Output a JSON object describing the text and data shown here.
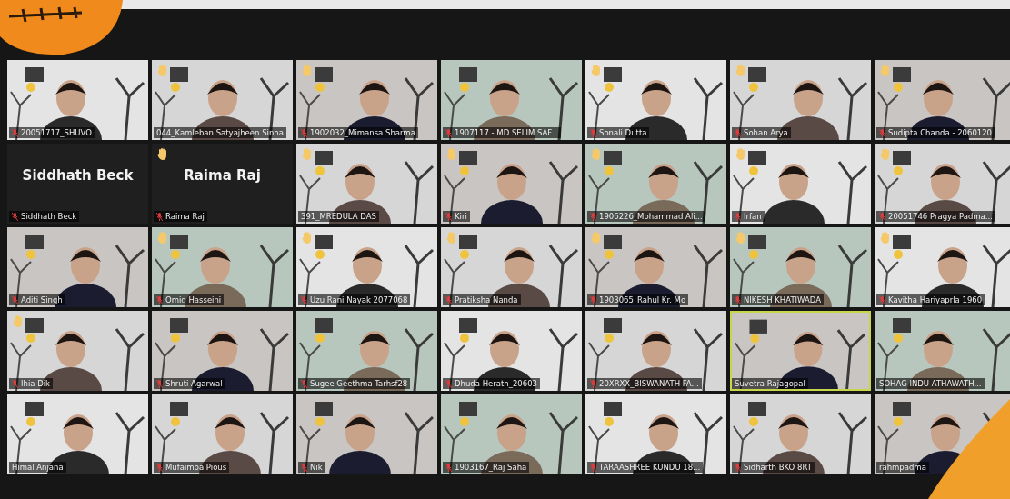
{
  "participants": [
    {
      "kind": "video",
      "name": "20051717_SHUVO",
      "muted": true,
      "hand_raised": false,
      "speaking": false
    },
    {
      "kind": "video",
      "name": "044_Kamleban Satyajheen Sinha",
      "muted": false,
      "hand_raised": true,
      "speaking": false
    },
    {
      "kind": "video",
      "name": "1902032_Mimansa Sharma",
      "muted": true,
      "hand_raised": true,
      "speaking": false
    },
    {
      "kind": "video",
      "name": "1907117 - MD SELIM SAF...",
      "muted": true,
      "hand_raised": false,
      "speaking": false
    },
    {
      "kind": "video",
      "name": "Sonali Dutta",
      "muted": true,
      "hand_raised": true,
      "speaking": false
    },
    {
      "kind": "video",
      "name": "Sohan Arya",
      "muted": true,
      "hand_raised": true,
      "speaking": false
    },
    {
      "kind": "video",
      "name": "Sudipta Chanda - 2060120",
      "muted": true,
      "hand_raised": true,
      "speaking": false
    },
    {
      "kind": "name",
      "display_name": "Siddhath Beck",
      "name": "Siddhath Beck",
      "muted": true,
      "hand_raised": false,
      "speaking": false
    },
    {
      "kind": "name",
      "display_name": "Raima Raj",
      "name": "Raima Raj",
      "muted": true,
      "hand_raised": true,
      "speaking": false
    },
    {
      "kind": "video",
      "name": "391_MREDULA DAS",
      "muted": false,
      "hand_raised": true,
      "speaking": false
    },
    {
      "kind": "video",
      "name": "Kiri",
      "muted": true,
      "hand_raised": true,
      "speaking": false
    },
    {
      "kind": "video",
      "name": "1906226_Mohammad Ali...",
      "muted": true,
      "hand_raised": true,
      "speaking": false
    },
    {
      "kind": "video",
      "name": "Irfan",
      "muted": true,
      "hand_raised": true,
      "speaking": false
    },
    {
      "kind": "video",
      "name": "20051746 Pragya Padma...",
      "muted": true,
      "hand_raised": true,
      "speaking": false
    },
    {
      "kind": "video",
      "name": "Aditi Singh",
      "muted": true,
      "hand_raised": false,
      "speaking": false
    },
    {
      "kind": "video",
      "name": "Omid Hasseini",
      "muted": true,
      "hand_raised": true,
      "speaking": false
    },
    {
      "kind": "video",
      "name": "Uzu Rani Nayak 2077068",
      "muted": true,
      "hand_raised": true,
      "speaking": false
    },
    {
      "kind": "video",
      "name": "Pratiksha Nanda",
      "muted": true,
      "hand_raised": true,
      "speaking": false
    },
    {
      "kind": "video",
      "name": "1903065_Rahul Kr. Mo",
      "muted": true,
      "hand_raised": true,
      "speaking": false
    },
    {
      "kind": "video",
      "name": "NIKESH KHATIWADA",
      "muted": true,
      "hand_raised": true,
      "speaking": false
    },
    {
      "kind": "video",
      "name": "Kavitha Hariyaprla 1960",
      "muted": true,
      "hand_raised": true,
      "speaking": false
    },
    {
      "kind": "video",
      "name": "Ihia Dik",
      "muted": true,
      "hand_raised": true,
      "speaking": false
    },
    {
      "kind": "video",
      "name": "Shruti Agarwal",
      "muted": true,
      "hand_raised": false,
      "speaking": false
    },
    {
      "kind": "video",
      "name": "Sugee Geethma Tarhsf28",
      "muted": true,
      "hand_raised": false,
      "speaking": false
    },
    {
      "kind": "video",
      "name": "Dhuda Herath_20603",
      "muted": true,
      "hand_raised": false,
      "speaking": false
    },
    {
      "kind": "video",
      "name": "20XRXX_BISWANATH FA...",
      "muted": true,
      "hand_raised": false,
      "speaking": false
    },
    {
      "kind": "video",
      "name": "Suvetra Rajagopal",
      "muted": false,
      "hand_raised": false,
      "speaking": true
    },
    {
      "kind": "video",
      "name": "SOHAG INDU ATHAWATH...",
      "muted": false,
      "hand_raised": false,
      "speaking": false
    },
    {
      "kind": "video",
      "name": "Himal Anjana",
      "muted": false,
      "hand_raised": false,
      "speaking": false
    },
    {
      "kind": "video",
      "name": "Mufaimba Pious",
      "muted": true,
      "hand_raised": false,
      "speaking": false
    },
    {
      "kind": "video",
      "name": "Nik",
      "muted": true,
      "hand_raised": false,
      "speaking": false
    },
    {
      "kind": "video",
      "name": "1903167_Raj Saha",
      "muted": true,
      "hand_raised": false,
      "speaking": false
    },
    {
      "kind": "video",
      "name": "TARAASHREE KUNDU 18...",
      "muted": true,
      "hand_raised": false,
      "speaking": false
    },
    {
      "kind": "video",
      "name": "Sidharth BKO 8RT",
      "muted": true,
      "hand_raised": false,
      "speaking": false
    },
    {
      "kind": "video",
      "name": "rahmpadma",
      "muted": false,
      "hand_raised": false,
      "speaking": false
    }
  ]
}
